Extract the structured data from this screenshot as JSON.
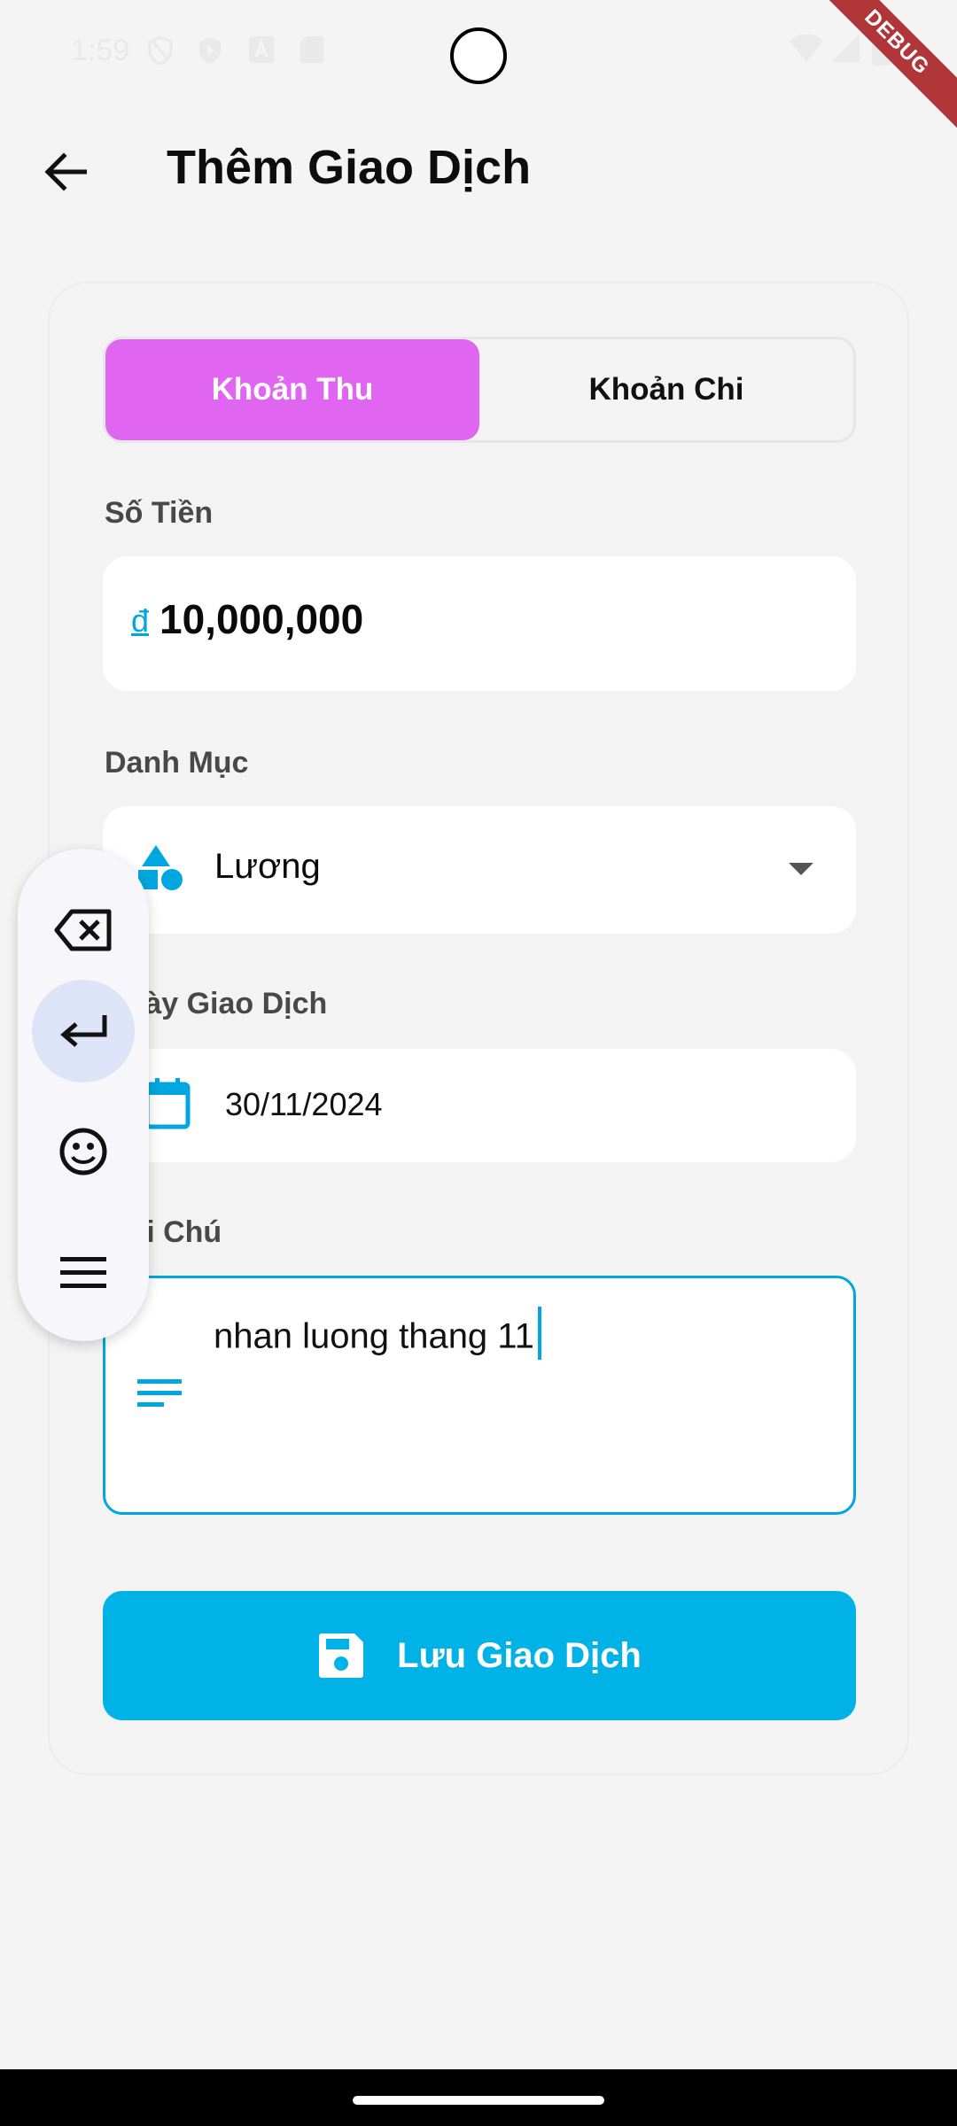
{
  "status_bar": {
    "time": "1:59",
    "debug_label": "DEBUG"
  },
  "header": {
    "title": "Thêm Giao Dịch"
  },
  "form": {
    "type_tabs": [
      {
        "label": "Khoản Thu",
        "selected": true
      },
      {
        "label": "Khoản Chi",
        "selected": false
      }
    ],
    "amount": {
      "label": "Số Tiền",
      "currency_symbol": "đ",
      "value": "10,000,000"
    },
    "category": {
      "label": "Danh Mục",
      "value": "Lương",
      "icon": "category-shapes-icon"
    },
    "date": {
      "label": "Ngày Giao Dịch",
      "value": "30/11/2024",
      "icon": "calendar-icon"
    },
    "note": {
      "label": "Ghi Chú",
      "value": "nhan luong thang 11",
      "icon": "notes-lines-icon"
    },
    "save_button": {
      "label": "Lưu Giao Dịch",
      "icon": "save-icon"
    }
  },
  "keyboard_toolbar": {
    "items": [
      "backspace-icon",
      "enter-icon",
      "emoji-icon",
      "menu-icon"
    ],
    "active": "enter-icon"
  },
  "colors": {
    "accent": "#00b2e6",
    "income_tab": "#e066f2",
    "background": "#f4f4f4"
  }
}
